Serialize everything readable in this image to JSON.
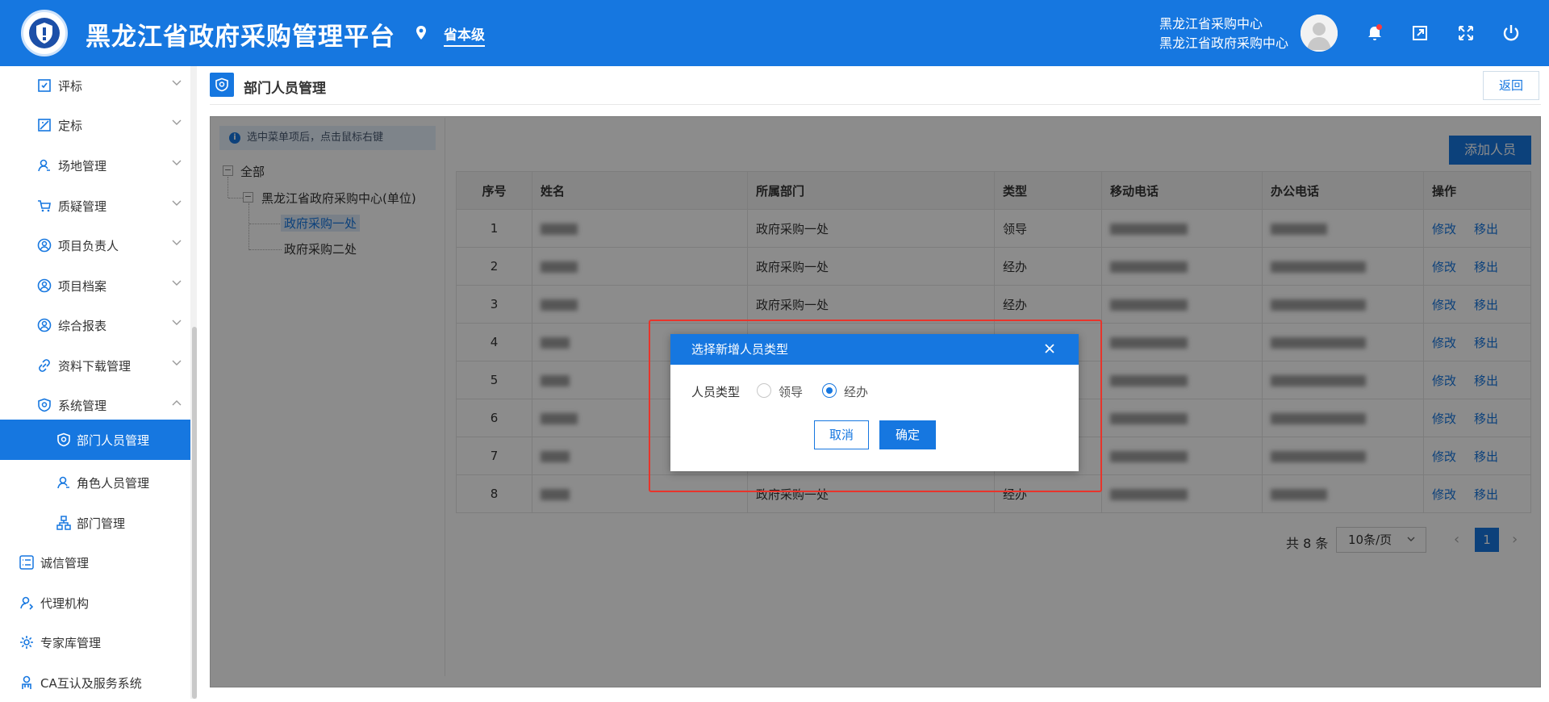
{
  "header": {
    "app_title": "黑龙江省政府采购管理平台",
    "location": "省本级",
    "user_line1": "黑龙江省采购中心",
    "user_line2": "黑龙江省政府采购中心",
    "icons": [
      "bell-icon",
      "export-icon",
      "fullscreen-icon",
      "power-icon"
    ]
  },
  "sidebar": {
    "items": [
      {
        "label": "评标",
        "icon": "review-icon"
      },
      {
        "label": "定标",
        "icon": "award-icon"
      },
      {
        "label": "场地管理",
        "icon": "venue-icon"
      },
      {
        "label": "质疑管理",
        "icon": "cart-icon"
      },
      {
        "label": "项目负责人",
        "icon": "user-circle-icon"
      },
      {
        "label": "项目档案",
        "icon": "user-circle-icon"
      },
      {
        "label": "综合报表",
        "icon": "user-circle-icon"
      },
      {
        "label": "资料下载管理",
        "icon": "link-icon"
      },
      {
        "label": "系统管理",
        "icon": "shield-icon"
      }
    ],
    "sub_items": [
      {
        "label": "部门人员管理",
        "icon": "shield-user-icon",
        "active": true
      },
      {
        "label": "角色人员管理",
        "icon": "user-role-icon"
      },
      {
        "label": "部门管理",
        "icon": "org-chart-icon"
      }
    ],
    "bottom_items": [
      {
        "label": "诚信管理",
        "icon": "list-icon"
      },
      {
        "label": "代理机构",
        "icon": "agency-icon"
      },
      {
        "label": "专家库管理",
        "icon": "gear-icon"
      },
      {
        "label": "CA互认及服务系统",
        "icon": "ca-icon"
      }
    ]
  },
  "page": {
    "title": "部门人员管理",
    "back_label": "返回",
    "tip": "选中菜单项后，点击鼠标右键",
    "tree": {
      "root": "全部",
      "unit": "黑龙江省政府采购中心(单位)",
      "children": [
        "政府采购一处",
        "政府采购二处"
      ]
    },
    "add_label": "添加人员",
    "table": {
      "headers": [
        "序号",
        "姓名",
        "所属部门",
        "类型",
        "移动电话",
        "办公电话",
        "操作"
      ],
      "rows": [
        {
          "no": "1",
          "dept": "政府采购一处",
          "type": "领导"
        },
        {
          "no": "2",
          "dept": "政府采购一处",
          "type": "经办"
        },
        {
          "no": "3",
          "dept": "政府采购一处",
          "type": "经办"
        },
        {
          "no": "4",
          "dept": "",
          "type": ""
        },
        {
          "no": "5",
          "dept": "",
          "type": ""
        },
        {
          "no": "6",
          "dept": "",
          "type": ""
        },
        {
          "no": "7",
          "dept": "",
          "type": ""
        },
        {
          "no": "8",
          "dept": "政府采购一处",
          "type": "经办"
        }
      ],
      "edit_label": "修改",
      "remove_label": "移出"
    },
    "pager": {
      "total": "共 8 条",
      "page_size": "10条/页",
      "current": "1"
    }
  },
  "dialog": {
    "title": "选择新增人员类型",
    "field_label": "人员类型",
    "option_leader": "领导",
    "option_handler": "经办",
    "selected": "经办",
    "cancel_label": "取消",
    "ok_label": "确定"
  },
  "colors": {
    "primary": "#1677e0",
    "highlight": "#e8342b"
  }
}
